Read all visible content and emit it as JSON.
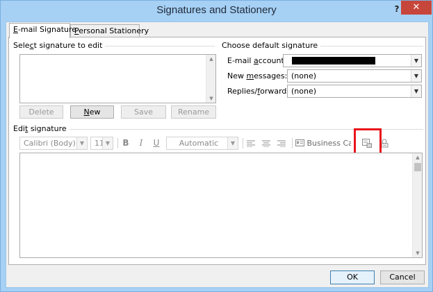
{
  "window": {
    "title": "Signatures and Stationery",
    "help_label": "?",
    "close_label": "✕"
  },
  "tabs": [
    {
      "label": "E-mail Signature",
      "accel": "E",
      "rest": "-mail Signature",
      "active": true
    },
    {
      "label": "Personal Stationery",
      "accel": "P",
      "rest": "ersonal Stationery",
      "active": false
    }
  ],
  "select_group": {
    "label_pre": "Sele",
    "label_accel": "c",
    "label_post": "t signature to edit",
    "items": []
  },
  "buttons": {
    "delete": "Delete",
    "new_accel": "N",
    "new_rest": "ew",
    "save": "Save",
    "rename": "Rename",
    "ok": "OK",
    "cancel": "Cancel"
  },
  "default_group": {
    "label": "Choose default signature",
    "email_account_pre": "E-mail ",
    "email_account_accel": "a",
    "email_account_post": "ccount:",
    "new_messages_pre": "New ",
    "new_messages_accel": "m",
    "new_messages_post": "essages:",
    "new_messages_value": "(none)",
    "replies_pre": "Replies/",
    "replies_accel": "f",
    "replies_post": "orwards:",
    "replies_value": "(none)"
  },
  "edit_group": {
    "label_pre": "Edi",
    "label_accel": "t",
    "label_post": " signature",
    "font_value": "Calibri (Body)",
    "size_value": "11",
    "bold": "B",
    "italic": "I",
    "underline": "U",
    "color_value": "Automatic",
    "business_card": "Business Card"
  },
  "colors": {
    "highlight": "#e8141b",
    "title_bar": "#a6d0f4",
    "close_button": "#c7463b"
  }
}
